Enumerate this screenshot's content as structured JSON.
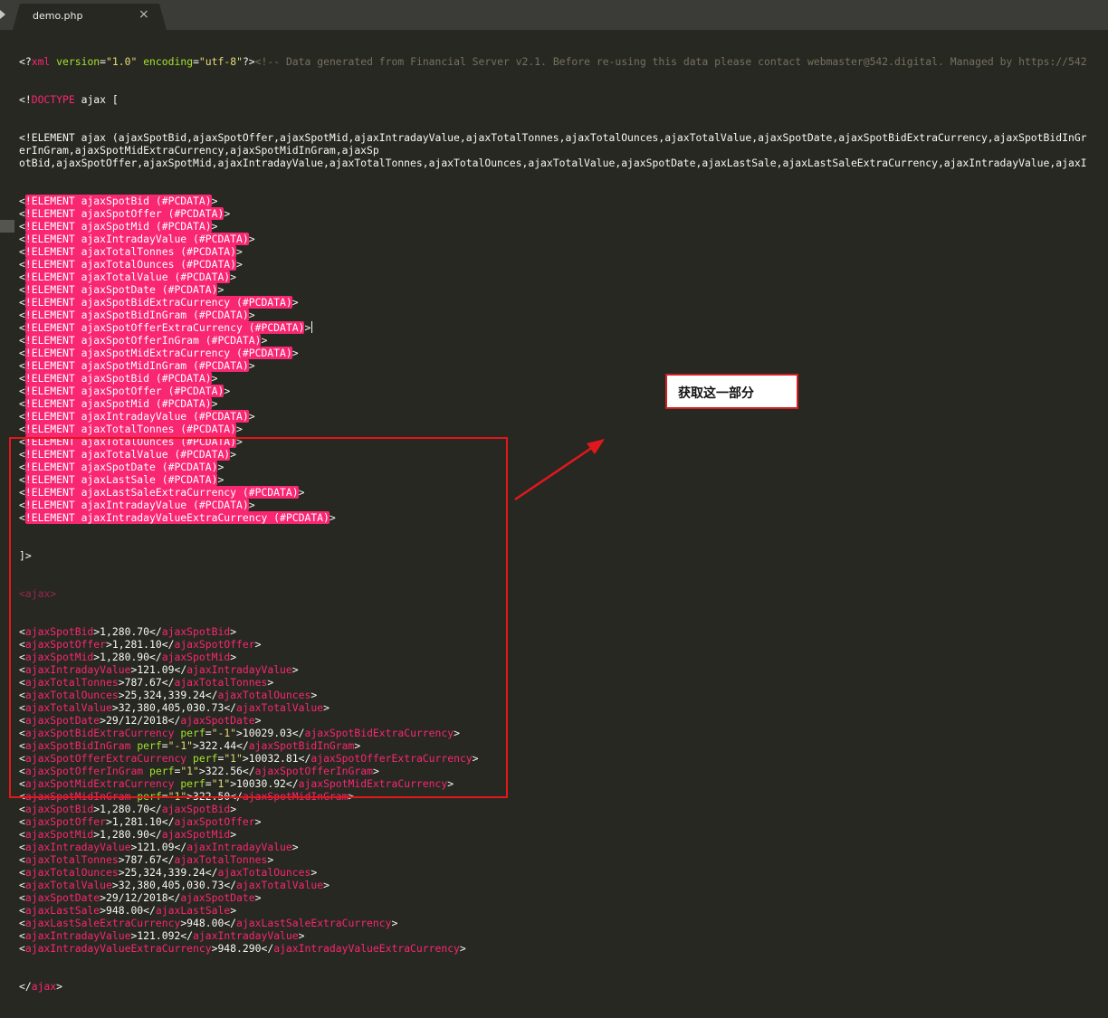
{
  "tab": {
    "title": "demo.php",
    "close_glyph": "×"
  },
  "colors": {
    "background": "#272822",
    "tag": "#f92672",
    "attr": "#a6e22e",
    "string": "#e6db74",
    "comment": "#75715e",
    "highlight": "#f92672",
    "annotation_border": "#e0181c"
  },
  "icons": {
    "tab_scroll": "triangle-right-icon",
    "close": "close-icon"
  },
  "annotation": {
    "label": "获取这一部分",
    "arrow": "red-arrow-icon"
  },
  "code": {
    "xml_decl": {
      "open": "<?",
      "name": "xml",
      "version_attr": "version",
      "version_val": "\"1.0\"",
      "encoding_attr": "encoding",
      "encoding_val": "\"utf-8\"",
      "close": "?>",
      "comment": "<!-- Data generated from Financial Server v2.1. Before re-using this data please contact webmaster@542.digital. Managed by https://542"
    },
    "doctype": {
      "open": "<!",
      "keyword": "DOCTYPE",
      "rest": " ajax ["
    },
    "element_decl_lines": [
      "<!ELEMENT ajax (ajaxSpotBid,ajaxSpotOffer,ajaxSpotMid,ajaxIntradayValue,ajaxTotalTonnes,ajaxTotalOunces,ajaxTotalValue,ajaxSpotDate,ajaxSpotBidExtraCurrency,ajaxSpotBidInGr",
      "erInGram,ajaxSpotMidExtraCurrency,ajaxSpotMidInGram,ajaxSp",
      "otBid,ajaxSpotOffer,ajaxSpotMid,ajaxIntradayValue,ajaxTotalTonnes,ajaxTotalOunces,ajaxTotalValue,ajaxSpotDate,ajaxLastSale,ajaxLastSaleExtraCurrency,ajaxIntradayValue,ajaxI"
    ],
    "elements": [
      "ELEMENT ajaxSpotBid (#PCDATA)",
      "ELEMENT ajaxSpotOffer (#PCDATA)",
      "ELEMENT ajaxSpotMid (#PCDATA)",
      "ELEMENT ajaxIntradayValue (#PCDATA)",
      "ELEMENT ajaxTotalTonnes (#PCDATA)",
      "ELEMENT ajaxTotalOunces (#PCDATA)",
      "ELEMENT ajaxTotalValue (#PCDATA)",
      "ELEMENT ajaxSpotDate (#PCDATA)",
      "ELEMENT ajaxSpotBidExtraCurrency (#PCDATA)",
      "ELEMENT ajaxSpotBidInGram (#PCDATA)",
      "ELEMENT ajaxSpotOfferExtraCurrency (#PCDATA)",
      "ELEMENT ajaxSpotOfferInGram (#PCDATA)",
      "ELEMENT ajaxSpotMidExtraCurrency (#PCDATA)",
      "ELEMENT ajaxSpotMidInGram (#PCDATA)",
      "ELEMENT ajaxSpotBid (#PCDATA)",
      "ELEMENT ajaxSpotOffer (#PCDATA)",
      "ELEMENT ajaxSpotMid (#PCDATA)",
      "ELEMENT ajaxIntradayValue (#PCDATA)",
      "ELEMENT ajaxTotalTonnes (#PCDATA)",
      "ELEMENT ajaxTotalOunces (#PCDATA)",
      "ELEMENT ajaxTotalValue (#PCDATA)",
      "ELEMENT ajaxSpotDate (#PCDATA)",
      "ELEMENT ajaxLastSale (#PCDATA)",
      "ELEMENT ajaxLastSaleExtraCurrency (#PCDATA)",
      "ELEMENT ajaxIntradayValue (#PCDATA)",
      "ELEMENT ajaxIntradayValueExtraCurrency (#PCDATA)"
    ],
    "element_prefix": "<!",
    "element_suffix": ">",
    "doctype_close": "]>",
    "root_tag": "ajax",
    "data_rows": [
      {
        "tag": "ajaxSpotBid",
        "attr": "",
        "attr_val": "",
        "value": "1,280.70"
      },
      {
        "tag": "ajaxSpotOffer",
        "attr": "",
        "attr_val": "",
        "value": "1,281.10"
      },
      {
        "tag": "ajaxSpotMid",
        "attr": "",
        "attr_val": "",
        "value": "1,280.90"
      },
      {
        "tag": "ajaxIntradayValue",
        "attr": "",
        "attr_val": "",
        "value": "121.09"
      },
      {
        "tag": "ajaxTotalTonnes",
        "attr": "",
        "attr_val": "",
        "value": "787.67"
      },
      {
        "tag": "ajaxTotalOunces",
        "attr": "",
        "attr_val": "",
        "value": "25,324,339.24"
      },
      {
        "tag": "ajaxTotalValue",
        "attr": "",
        "attr_val": "",
        "value": "32,380,405,030.73"
      },
      {
        "tag": "ajaxSpotDate",
        "attr": "",
        "attr_val": "",
        "value": "29/12/2018"
      },
      {
        "tag": "ajaxSpotBidExtraCurrency",
        "attr": "perf",
        "attr_val": "\"-1\"",
        "value": "10029.03"
      },
      {
        "tag": "ajaxSpotBidInGram",
        "attr": "perf",
        "attr_val": "\"-1\"",
        "value": "322.44"
      },
      {
        "tag": "ajaxSpotOfferExtraCurrency",
        "attr": "perf",
        "attr_val": "\"1\"",
        "value": "10032.81"
      },
      {
        "tag": "ajaxSpotOfferInGram",
        "attr": "perf",
        "attr_val": "\"1\"",
        "value": "322.56"
      },
      {
        "tag": "ajaxSpotMidExtraCurrency",
        "attr": "perf",
        "attr_val": "\"1\"",
        "value": "10030.92"
      },
      {
        "tag": "ajaxSpotMidInGram",
        "attr": "perf",
        "attr_val": "\"1\"",
        "value": "322.50"
      },
      {
        "tag": "ajaxSpotBid",
        "attr": "",
        "attr_val": "",
        "value": "1,280.70"
      },
      {
        "tag": "ajaxSpotOffer",
        "attr": "",
        "attr_val": "",
        "value": "1,281.10"
      },
      {
        "tag": "ajaxSpotMid",
        "attr": "",
        "attr_val": "",
        "value": "1,280.90"
      },
      {
        "tag": "ajaxIntradayValue",
        "attr": "",
        "attr_val": "",
        "value": "121.09"
      },
      {
        "tag": "ajaxTotalTonnes",
        "attr": "",
        "attr_val": "",
        "value": "787.67"
      },
      {
        "tag": "ajaxTotalOunces",
        "attr": "",
        "attr_val": "",
        "value": "25,324,339.24"
      },
      {
        "tag": "ajaxTotalValue",
        "attr": "",
        "attr_val": "",
        "value": "32,380,405,030.73"
      },
      {
        "tag": "ajaxSpotDate",
        "attr": "",
        "attr_val": "",
        "value": "29/12/2018"
      },
      {
        "tag": "ajaxLastSale",
        "attr": "",
        "attr_val": "",
        "value": "948.00"
      },
      {
        "tag": "ajaxLastSaleExtraCurrency",
        "attr": "",
        "attr_val": "",
        "value": "948.00"
      },
      {
        "tag": "ajaxIntradayValue",
        "attr": "",
        "attr_val": "",
        "value": "121.092"
      },
      {
        "tag": "ajaxIntradayValueExtraCurrency",
        "attr": "",
        "attr_val": "",
        "value": "948.290"
      }
    ]
  }
}
